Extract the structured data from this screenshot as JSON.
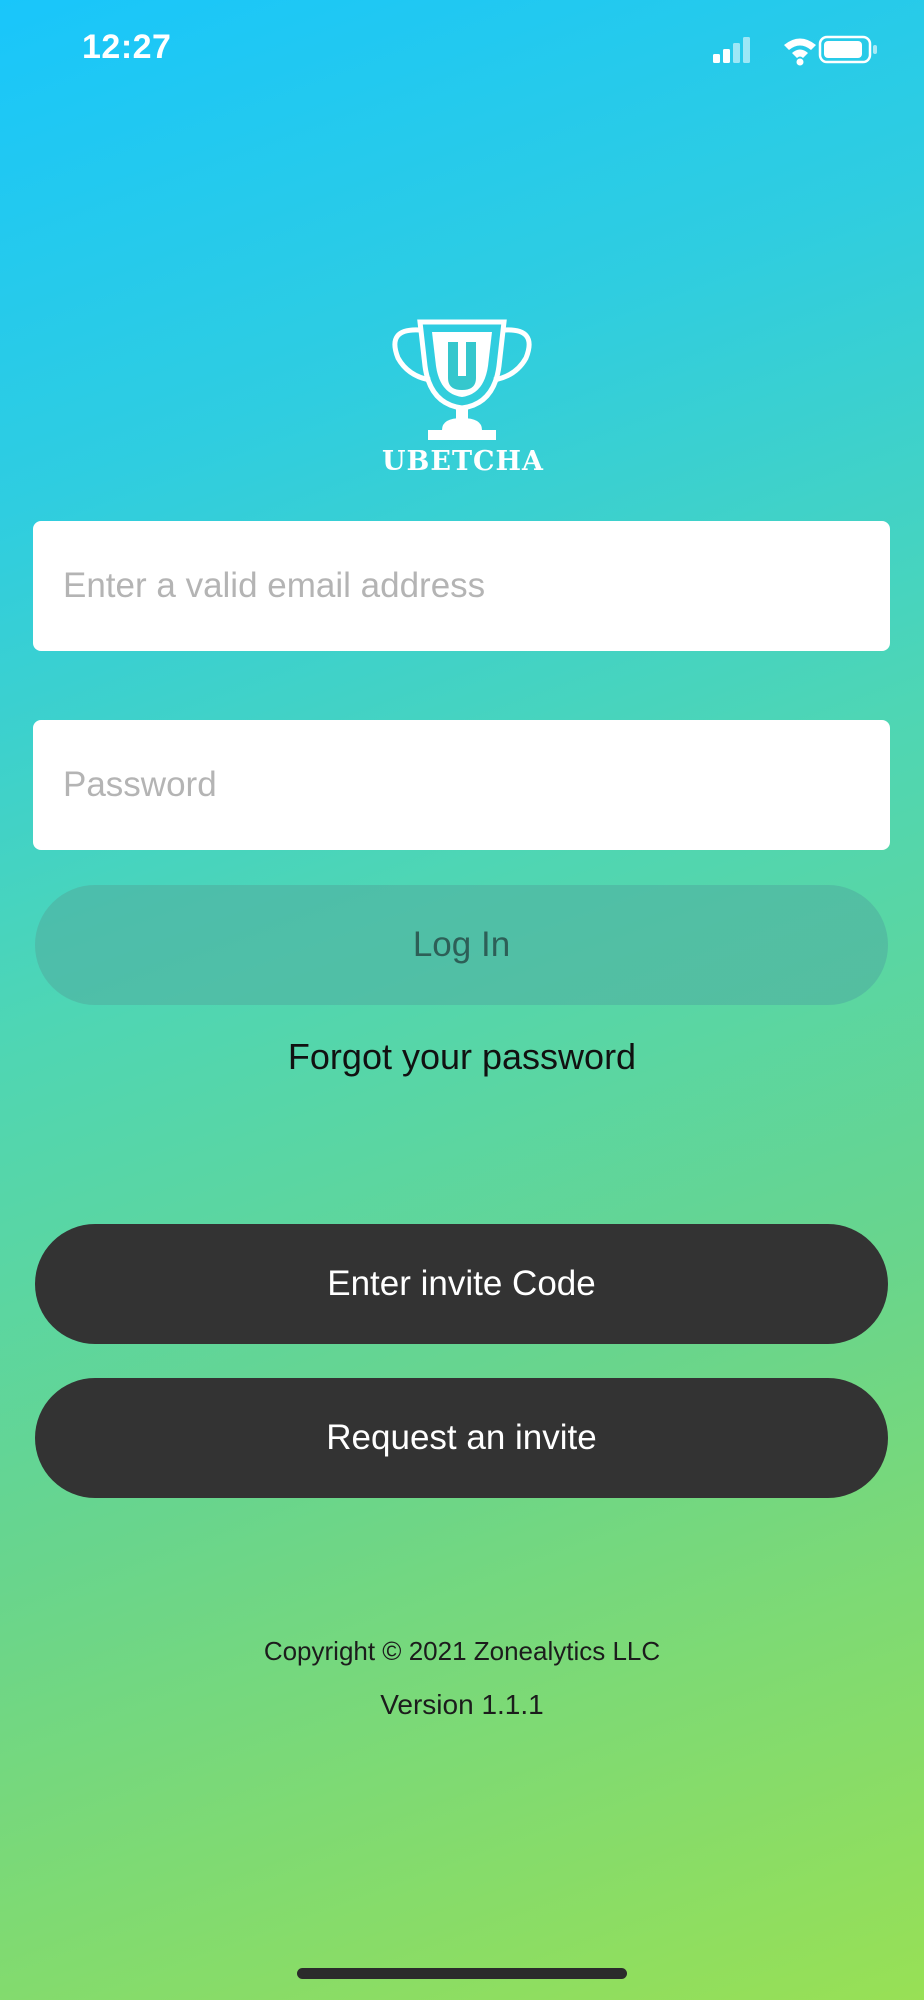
{
  "status_bar": {
    "time": "12:27",
    "icons": [
      "cellular-signal-icon",
      "wifi-icon",
      "battery-icon"
    ]
  },
  "logo": {
    "icon": "trophy-icon",
    "text": "UBETCHA"
  },
  "login_form": {
    "email_placeholder": "Enter a valid email address",
    "email_value": "",
    "password_placeholder": "Password",
    "password_value": "",
    "login_label": "Log In",
    "forgot_label": "Forgot your password"
  },
  "invite": {
    "code_label": "Enter invite Code",
    "request_label": "Request an invite"
  },
  "footer": {
    "copyright": "Copyright © 2021 Zonealytics LLC",
    "version": "Version 1.1.1"
  },
  "colors": {
    "gradient_top": "#19c6fb",
    "gradient_bottom": "#98e055",
    "dark_button": "#333333",
    "white": "#ffffff"
  }
}
